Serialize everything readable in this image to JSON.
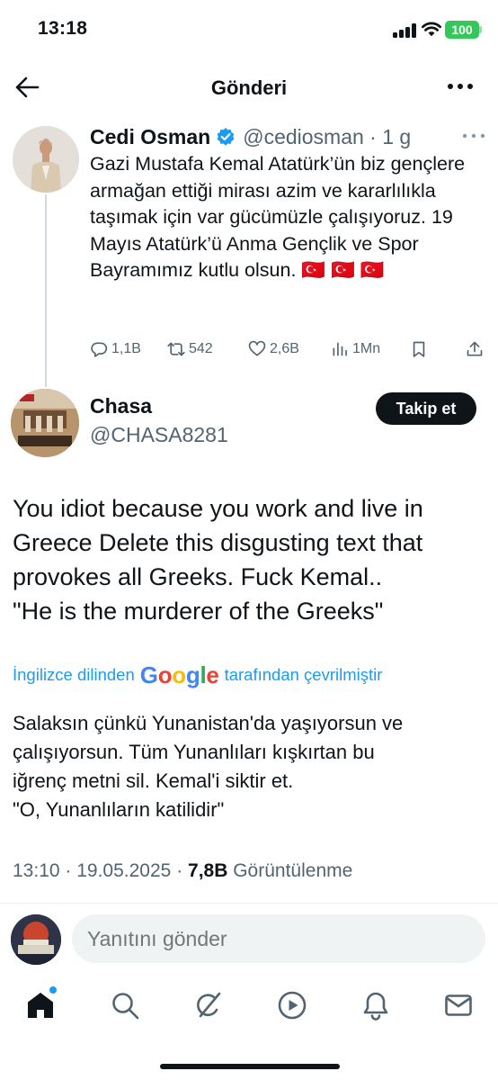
{
  "status_bar": {
    "time": "13:18",
    "battery": "100"
  },
  "header": {
    "title": "Gönderi"
  },
  "tweet": {
    "author_name": "Cedi Osman",
    "handle": "@cediosman",
    "age": "1 g",
    "text": "Gazi Mustafa Kemal Atatürk’ün biz gençlere armağan ettiği mirası azim ve kararlılıkla taşımak için var gücümüzle çalışıyoruz. 19 Mayıs Atatürk’ü Anma Gençlik ve Spor Bayramımız kutlu olsun. 🇹🇷 🇹🇷 🇹🇷",
    "replies": "1,1B",
    "retweets": "542",
    "likes": "2,6B",
    "views": "1Mn"
  },
  "reply": {
    "author_name": "Chasa",
    "handle": "@CHASA8281",
    "follow_label": "Takip et",
    "text_lines": [
      "You idiot because you work and live in",
      "Greece Delete this disgusting text that",
      "provokes all Greeks. Fuck Kemal..",
      "\"He is the murderer of the Greeks\""
    ],
    "translate_prefix": "İngilizce dilinden",
    "translate_engine": "Google",
    "translate_suffix": "tarafından çevrilmiştir",
    "translated_lines": [
      "Salaksın çünkü Yunanistan'da yaşıyorsun ve",
      "çalışıyorsun. Tüm Yunanlıları kışkırtan bu",
      "iğrenç metni sil. Kemal'i siktir et.",
      "\"O, Yunanlıların katilidir\""
    ],
    "time": "13:10",
    "date": "19.05.2025",
    "views": "7,8B",
    "views_label": "Görüntülenme"
  },
  "composer": {
    "placeholder": "Yanıtını gönder"
  },
  "tabbar": {
    "icons": [
      "home-icon",
      "search-icon",
      "grok-icon",
      "video-icon",
      "notifications-icon",
      "messages-icon"
    ]
  },
  "colors": {
    "accent": "#1d9bf0",
    "battery": "#34c759",
    "text": "#0f1419",
    "muted": "#536471"
  }
}
